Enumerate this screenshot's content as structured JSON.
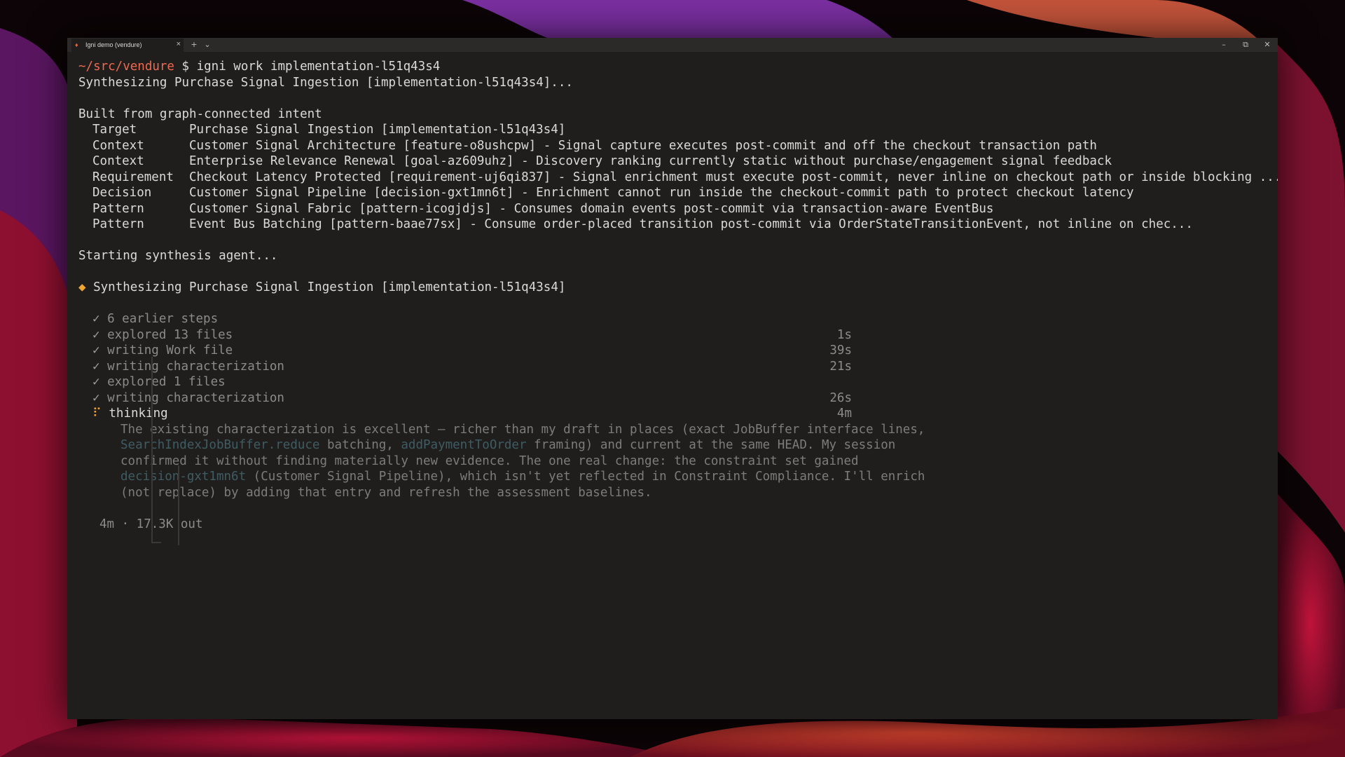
{
  "window": {
    "tab_title": "Igni demo (vendure)",
    "tab_close": "×",
    "new_tab": "+",
    "tab_menu": "⌄",
    "minimize": "–",
    "restore": "⧉",
    "close": "✕"
  },
  "terminal": {
    "prompt_path": "~/src/vendure",
    "prompt_symbol": "$",
    "command": "igni work implementation-l51q43s4",
    "synth_line": "Synthesizing Purchase Signal Ingestion [implementation-l51q43s4]...",
    "built_from": "Built from graph-connected intent",
    "intent_rows": [
      {
        "key": "Target",
        "value": "Purchase Signal Ingestion [implementation-l51q43s4]"
      },
      {
        "key": "Context",
        "value": "Customer Signal Architecture [feature-o8ushcpw] - Signal capture executes post-commit and off the checkout transaction path"
      },
      {
        "key": "Context",
        "value": "Enterprise Relevance Renewal [goal-az609uhz] - Discovery ranking currently static without purchase/engagement signal feedback"
      },
      {
        "key": "Requirement",
        "value": "Checkout Latency Protected [requirement-uj6qi837] - Signal enrichment must execute post-commit, never inline on checkout path or inside blocking ..."
      },
      {
        "key": "Decision",
        "value": "Customer Signal Pipeline [decision-gxt1mn6t] - Enrichment cannot run inside the checkout-commit path to protect checkout latency"
      },
      {
        "key": "Pattern",
        "value": "Customer Signal Fabric [pattern-icogjdjs] - Consumes domain events post-commit via transaction-aware EventBus"
      },
      {
        "key": "Pattern",
        "value": "Event Bus Batching [pattern-baae77sx] - Consume order-placed transition post-commit via OrderStateTransitionEvent, not inline on chec..."
      }
    ],
    "starting": "Starting synthesis agent...",
    "diamond": "◆",
    "header": "Synthesizing Purchase Signal Ingestion [implementation-l51q43s4]",
    "check_mark": "✓",
    "steps": [
      {
        "label": "6 earlier steps",
        "duration": ""
      },
      {
        "label": "explored 13 files",
        "duration": "1s"
      },
      {
        "label": "writing Work file",
        "duration": "39s"
      },
      {
        "label": "writing characterization",
        "duration": "21s"
      },
      {
        "label": "explored 1 files",
        "duration": ""
      },
      {
        "label": "writing characterization",
        "duration": "26s"
      }
    ],
    "current": {
      "spinner": "⠏",
      "label": "thinking",
      "duration": "4m"
    },
    "thinking": {
      "l1": "The existing characterization is excellent — richer than my draft in places (exact JobBuffer interface lines,",
      "l2_code1": "SearchIndexJobBuffer.reduce",
      "l2_mid": " batching, ",
      "l2_code2": "addPaymentToOrder",
      "l2_end": " framing) and current at the same HEAD. My session",
      "l3": "confirmed it without finding materially new evidence. The one real change: the constraint set gained",
      "l4_code": "decision-gxt1mn6t",
      "l4_end": " (Customer Signal Pipeline), which isn't yet reflected in Constraint Compliance. I'll enrich",
      "l5": "(not replace) by adding that entry and refresh the assessment baselines."
    },
    "footer": "4m · 17.3K out"
  }
}
